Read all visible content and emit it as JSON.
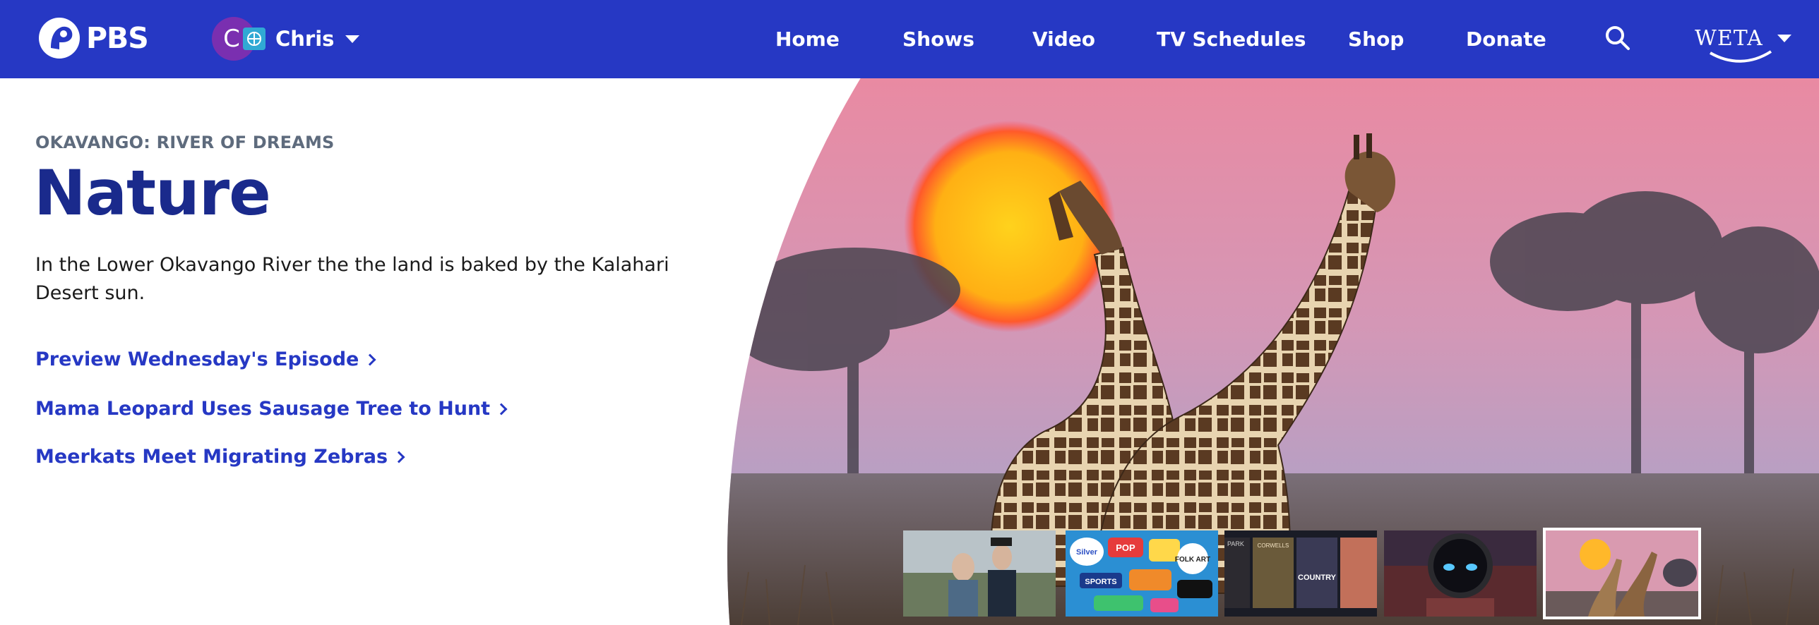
{
  "nav": {
    "logo_text": "PBS",
    "profile": {
      "initial": "C",
      "name": "Chris"
    },
    "links": [
      {
        "label": "Home"
      },
      {
        "label": "Shows"
      },
      {
        "label": "Video"
      },
      {
        "label": "TV Schedules"
      },
      {
        "label": "Shop"
      },
      {
        "label": "Donate"
      }
    ],
    "search_icon": "search-icon",
    "station": {
      "name": "WETA"
    }
  },
  "hero": {
    "eyebrow": "OKAVANGO: RIVER OF DREAMS",
    "title": "Nature",
    "description": "In the Lower Okavango River the the land is baked by the Kalahari Desert sun.",
    "links": [
      {
        "label": "Preview Wednesday's Episode"
      },
      {
        "label": "Mama Leopard Uses Sausage Tree to Hunt"
      },
      {
        "label": "Meerkats Meet Migrating Zebras"
      }
    ]
  },
  "carousel": {
    "thumbnails": [
      {
        "label": ""
      },
      {
        "label": ""
      },
      {
        "label": ""
      },
      {
        "label": ""
      },
      {
        "label": "",
        "active": true
      }
    ],
    "thumb2_words": [
      "Silver",
      "POP",
      "FOLK ART",
      "SPORTS"
    ],
    "thumb3_words": [
      "PARK",
      "CORWELLS",
      "COUNTRY"
    ]
  },
  "colors": {
    "nav_bg": "#2638c4",
    "title": "#1a2a8c",
    "link": "#2638c4",
    "eyebrow": "#5e6b7d"
  }
}
